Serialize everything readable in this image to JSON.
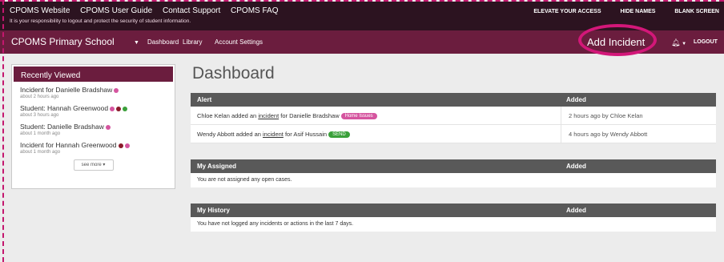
{
  "topbar": {
    "links": [
      "CPOMS Website",
      "CPOMS User Guide",
      "Contact Support",
      "CPOMS FAQ"
    ],
    "notice": "It is your responsibility to logout and protect the security of student information.",
    "actions": [
      "ELEVATE YOUR ACCESS",
      "HIDE NAMES",
      "BLANK SCREEN"
    ]
  },
  "nav": {
    "school": "CPOMS Primary School",
    "links": [
      "Dashboard",
      "Library",
      "Account Settings"
    ],
    "add_incident": "Add Incident",
    "logout": "LOGOUT"
  },
  "sidebar": {
    "title": "Recently Viewed",
    "items": [
      {
        "prefix": "Incident",
        "rest": " for Danielle Bradshaw",
        "time": "about 2 hours ago"
      },
      {
        "prefix": "",
        "rest": "Student: Hannah Greenwood",
        "time": "about 3 hours ago"
      },
      {
        "prefix": "",
        "rest": "Student: Danielle Bradshaw",
        "time": "about 1 month ago"
      },
      {
        "prefix": "Incident",
        "rest": " for Hannah Greenwood",
        "time": "about 1 month ago"
      }
    ],
    "see_more": "see more"
  },
  "main": {
    "title": "Dashboard",
    "alert": {
      "header": "Alert",
      "added_header": "Added",
      "rows": [
        {
          "pre": "Chloe Kelan added an ",
          "link": "incident",
          "post": " for Danielle Bradshaw",
          "badge": "Home Issues",
          "added": "2 hours ago by Chloe Kelan"
        },
        {
          "pre": "Wendy Abbott added an ",
          "link": "incident",
          "post": " for Asif Hussain",
          "badge": "SEND",
          "added": "4 hours ago by Wendy Abbott"
        }
      ]
    },
    "assigned": {
      "header": "My Assigned",
      "added_header": "Added",
      "empty": "You are not assigned any open cases."
    },
    "history": {
      "header": "My History",
      "added_header": "Added",
      "empty": "You have not logged any incidents or actions in the last 7 days."
    }
  },
  "colors": {
    "pink": "#d5559f",
    "dark_red": "#8b1a2b",
    "green": "#3aa03a"
  }
}
